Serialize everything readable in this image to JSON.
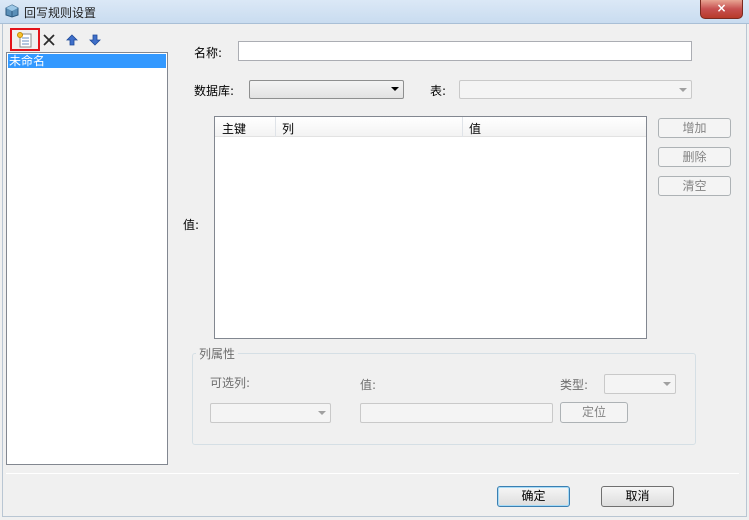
{
  "window": {
    "title": "回写规则设置",
    "close": "×"
  },
  "rules": {
    "items": [
      "未命名"
    ]
  },
  "form": {
    "name_label": "名称:",
    "name_value": "",
    "database_label": "数据库:",
    "database_value": "",
    "table_label": "表:",
    "table_value": "",
    "values_label": "值:",
    "grid_columns": [
      "主键",
      "列",
      "值"
    ],
    "add_label": "增加",
    "delete_label": "删除",
    "clear_label": "清空"
  },
  "column_attr": {
    "group_title": "列属性",
    "optional_col_label": "可选列:",
    "value_label": "值:",
    "type_label": "类型:",
    "locate_label": "定位"
  },
  "footer": {
    "ok_label": "确定",
    "cancel_label": "取消"
  },
  "colors": {
    "selection": "#3399ff",
    "highlight_border": "#e4141b"
  },
  "icons": [
    "app-icon",
    "new-rule-icon",
    "delete-icon",
    "move-up-icon",
    "move-down-icon"
  ]
}
